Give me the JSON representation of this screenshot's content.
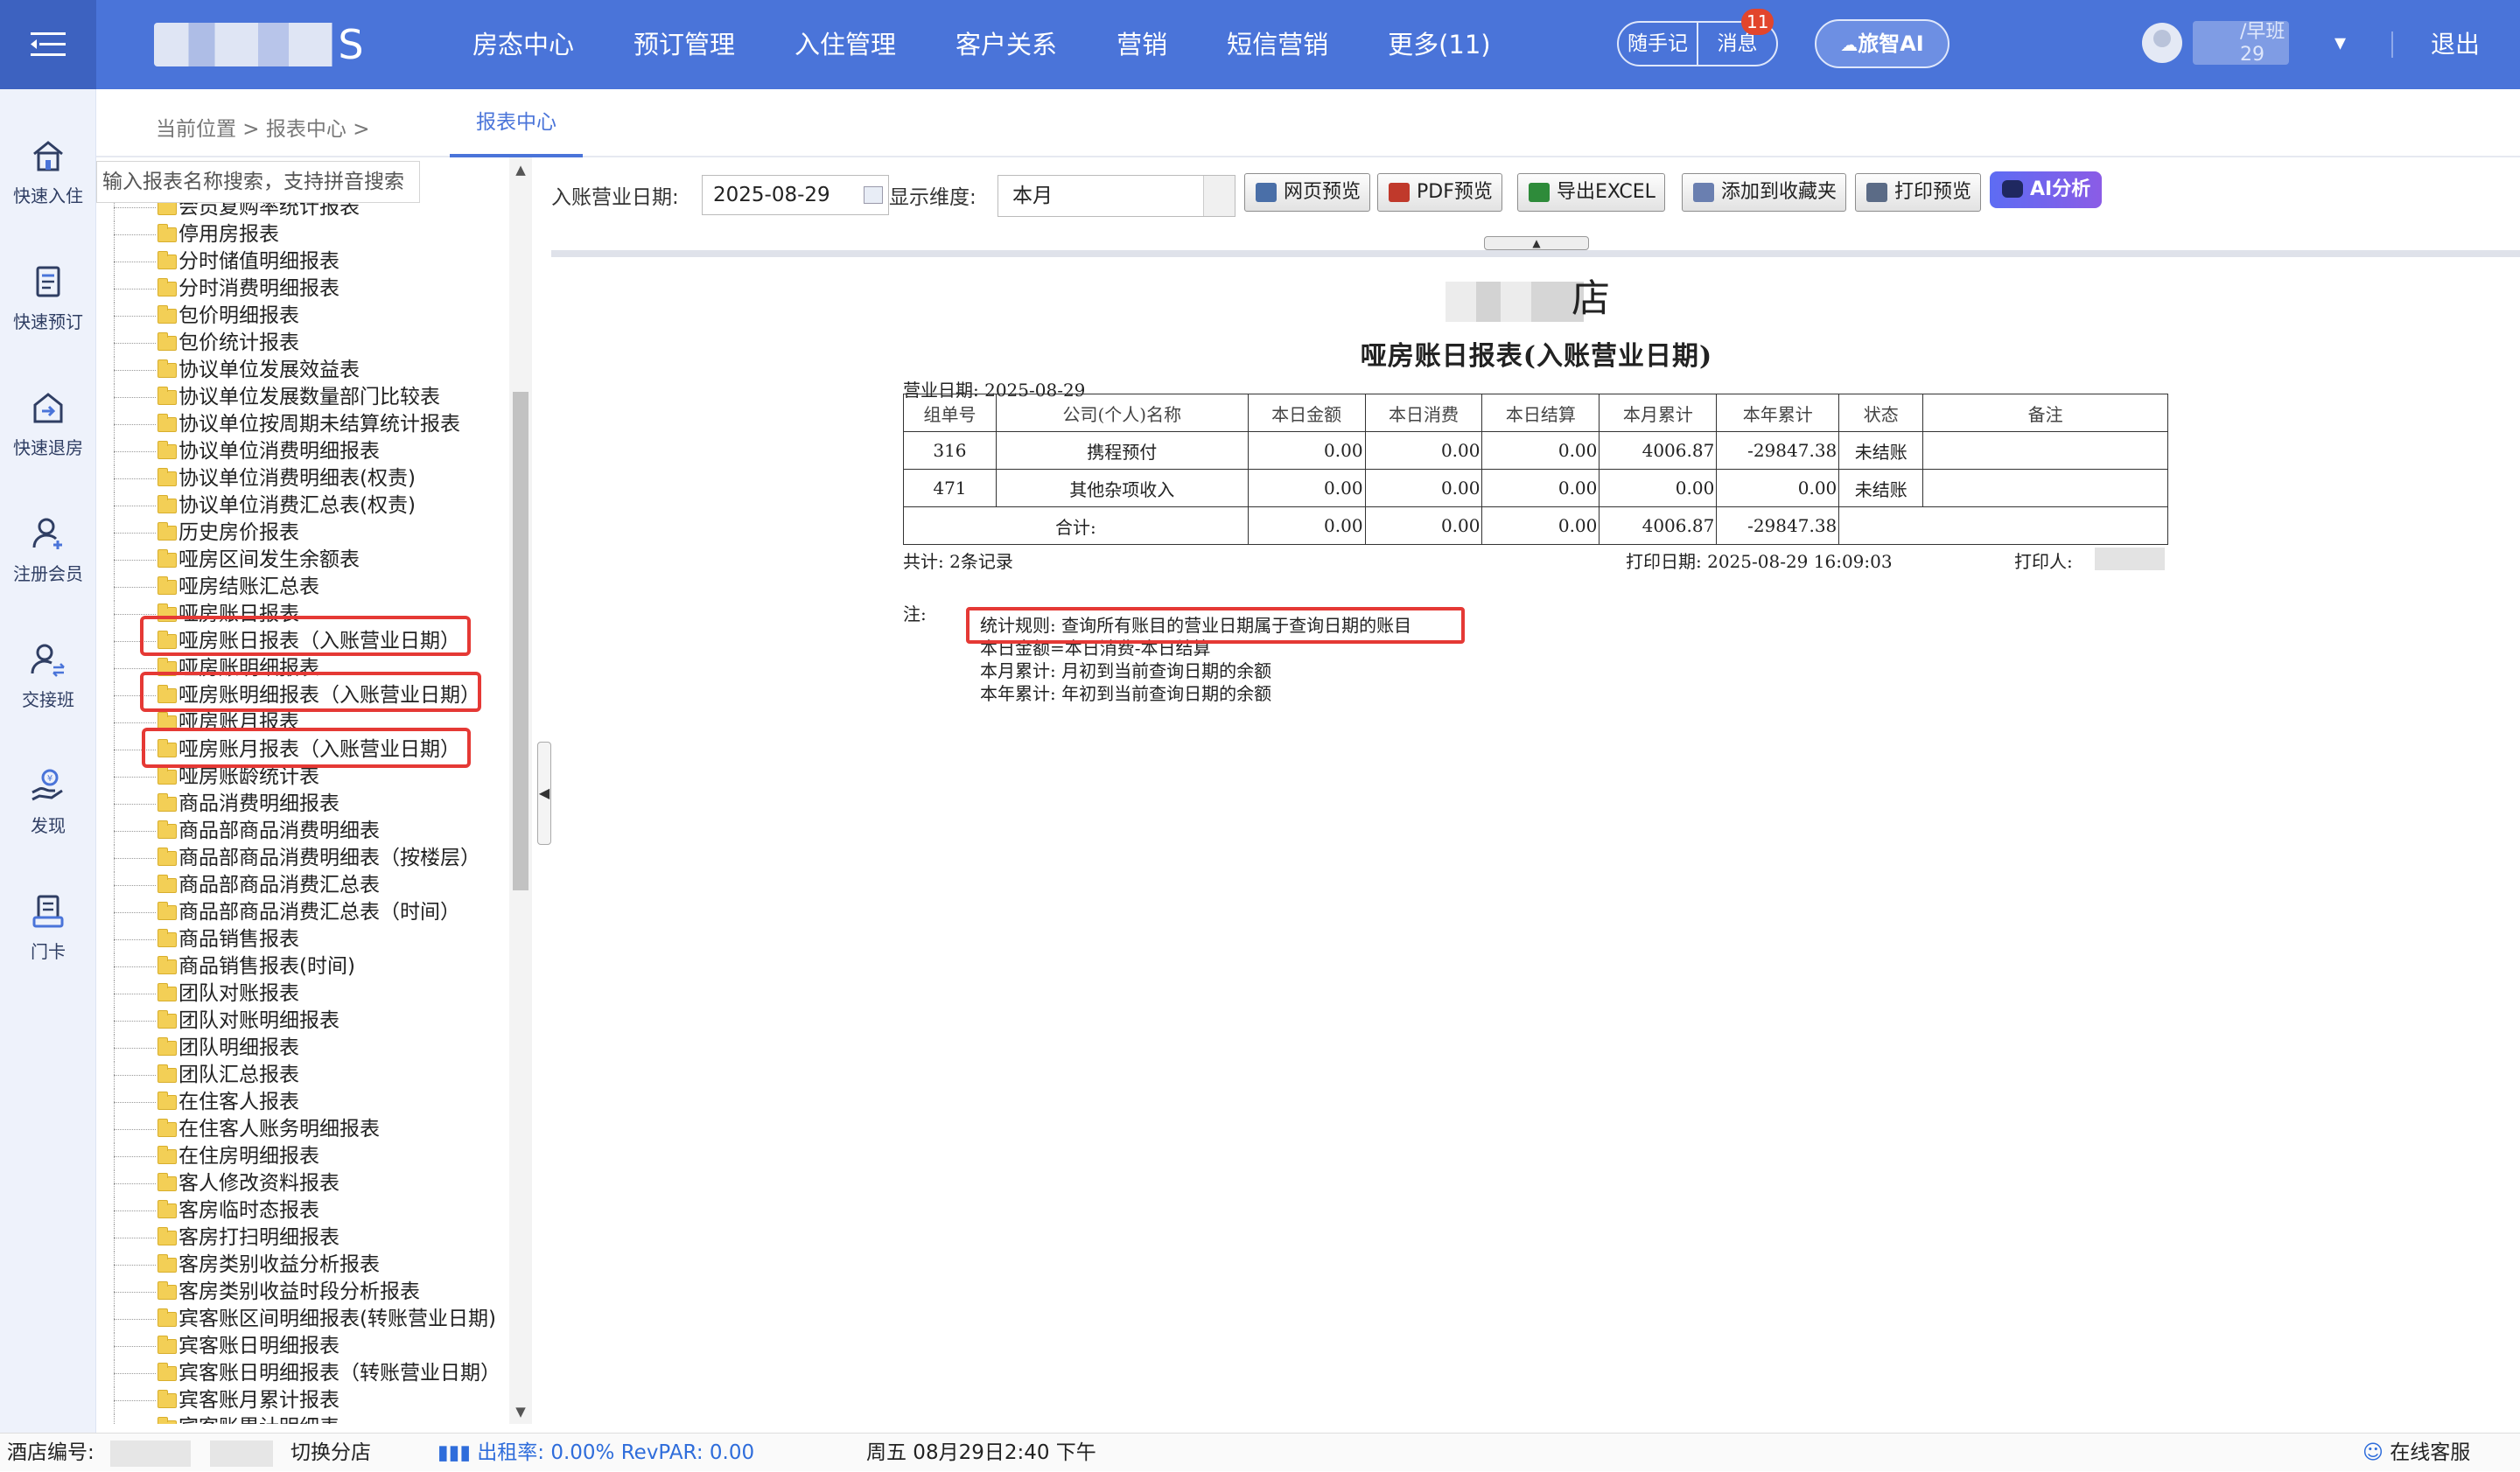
{
  "header": {
    "logo_tail": "S",
    "nav": [
      "房态中心",
      "预订管理",
      "入住管理",
      "客户关系",
      "营销",
      "短信营销",
      "更多(11)"
    ],
    "quick_note": "随手记",
    "messages": "消息",
    "message_count": "11",
    "ai_button": "旅智AI",
    "user_shift": "/早班",
    "user_suffix": "29",
    "logout": "退出"
  },
  "sidebar": {
    "items": [
      {
        "label": "快速入住",
        "icon": "home-icon"
      },
      {
        "label": "快速预订",
        "icon": "booking-list-icon"
      },
      {
        "label": "快速退房",
        "icon": "checkout-house-icon"
      },
      {
        "label": "注册会员",
        "icon": "add-member-icon"
      },
      {
        "label": "交接班",
        "icon": "shift-handover-icon"
      },
      {
        "label": "发现",
        "icon": "discover-hand-coin-icon"
      },
      {
        "label": "门卡",
        "icon": "room-card-icon"
      }
    ]
  },
  "breadcrumb": {
    "text": "当前位置  >  报表中心  >",
    "active_tab": "报表中心"
  },
  "tree": {
    "search_placeholder": "输入报表名称搜索，支持拼音搜索",
    "items": [
      "会员复购率统计报表",
      "停用房报表",
      "分时储值明细报表",
      "分时消费明细报表",
      "包价明细报表",
      "包价统计报表",
      "协议单位发展效益表",
      "协议单位发展数量部门比较表",
      "协议单位按周期未结算统计报表",
      "协议单位消费明细报表",
      "协议单位消费明细表(权责)",
      "协议单位消费汇总表(权责)",
      "历史房价报表",
      "哑房区间发生余额表",
      "哑房结账汇总表",
      "哑房账日报表",
      "哑房账日报表（入账营业日期）",
      "哑房账明细报表",
      "哑房账明细报表（入账营业日期）",
      "哑房账月报表",
      "哑房账月报表（入账营业日期）",
      "哑房账龄统计表",
      "商品消费明细报表",
      "商品部商品消费明细表",
      "商品部商品消费明细表（按楼层）",
      "商品部商品消费汇总表",
      "商品部商品消费汇总表（时间）",
      "商品销售报表",
      "商品销售报表(时间)",
      "团队对账报表",
      "团队对账明细报表",
      "团队明细报表",
      "团队汇总报表",
      "在住客人报表",
      "在住客人账务明细报表",
      "在住房明细报表",
      "客人修改资料报表",
      "客房临时态报表",
      "客房打扫明细报表",
      "客房类别收益分析报表",
      "客房类别收益时段分析报表",
      "宾客账区间明细报表(转账营业日期)",
      "宾客账日明细报表",
      "宾客账日明细报表（转账营业日期）",
      "宾客账月累计报表",
      "宾客账累计明细表"
    ]
  },
  "toolbar": {
    "date_label": "入账营业日期:",
    "date_value": "2025-08-29",
    "dimension_label": "显示维度:",
    "dimension_value": "本月",
    "buttons": [
      {
        "label": "网页预览",
        "icon": "web-preview-icon",
        "color": "#4a6fa8"
      },
      {
        "label": "PDF预览",
        "icon": "pdf-icon",
        "color": "#c0392b"
      },
      {
        "label": "导出EXCEL",
        "icon": "excel-icon",
        "color": "#2e8b3a"
      },
      {
        "label": "添加到收藏夹",
        "icon": "favorites-icon",
        "color": "#6a7fb0"
      },
      {
        "label": "打印预览",
        "icon": "printer-icon",
        "color": "#5b6b86"
      }
    ],
    "ai_analyze": "AI分析"
  },
  "report": {
    "hotel_name_tail": "店",
    "title": "哑房账日报表(入账营业日期)",
    "business_date": "营业日期: 2025-08-29",
    "columns": [
      "组单号",
      "公司(个人)名称",
      "本日金额",
      "本日消费",
      "本日结算",
      "本月累计",
      "本年累计",
      "状态",
      "备注"
    ],
    "rows": [
      [
        "316",
        "携程预付",
        "0.00",
        "0.00",
        "0.00",
        "4006.87",
        "-29847.38",
        "未结账",
        ""
      ],
      [
        "471",
        "其他杂项收入",
        "0.00",
        "0.00",
        "0.00",
        "0.00",
        "0.00",
        "未结账",
        ""
      ]
    ],
    "total": [
      "合计:",
      "0.00",
      "0.00",
      "0.00",
      "4006.87",
      "-29847.38",
      ""
    ],
    "record_count": "共计: 2条记录",
    "print_date": "打印日期: 2025-08-29 16:09:03",
    "printer": "打印人:",
    "note_label": "注:",
    "notes": [
      "统计规则: 查询所有账目的营业日期属于查询日期的账目",
      "本日金额=本日消费-本日结算",
      "本月累计: 月初到当前查询日期的余额",
      "本年累计: 年初到当前查询日期的余额"
    ]
  },
  "statusbar": {
    "hotel_id_label": "酒店编号:",
    "switch_branch": "切换分店",
    "occupancy": "出租率: 0.00% RevPAR: 0.00",
    "datetime": "周五 08月29日2:40 下午",
    "online_service": "在线客服"
  },
  "colors": {
    "header_bg": "#4a74d9",
    "highlight": "#e53935",
    "badge": "#e2452c"
  }
}
